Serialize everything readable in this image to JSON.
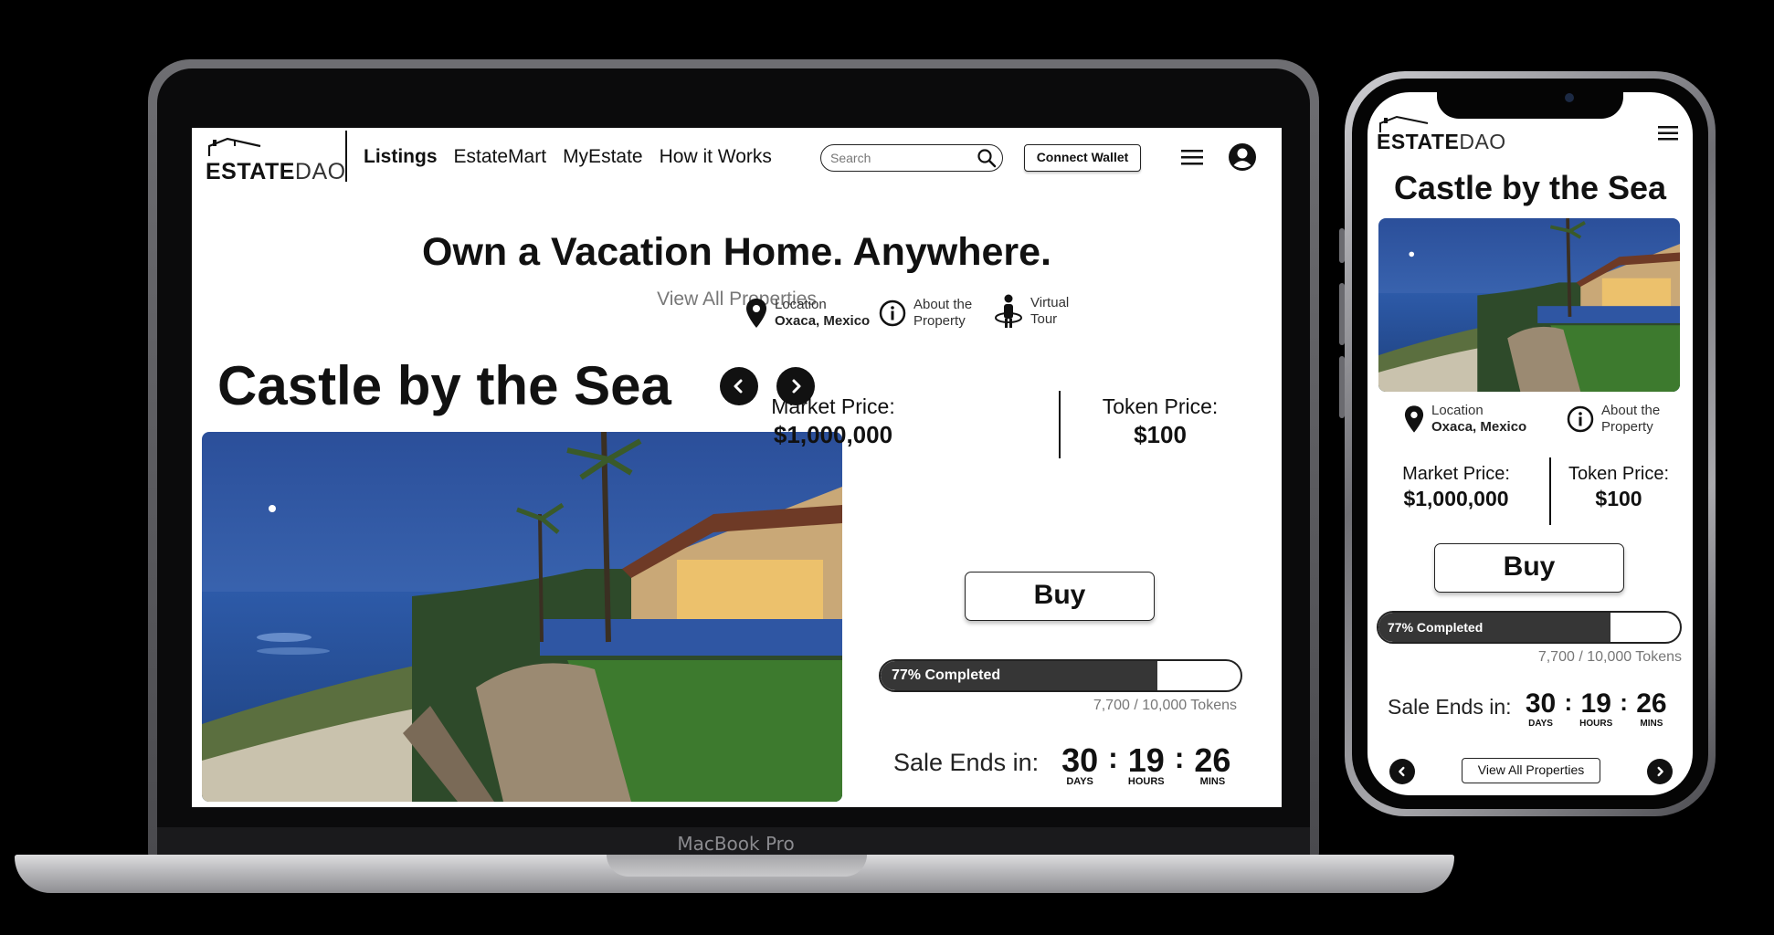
{
  "brand": {
    "logo_bold": "ESTATE",
    "logo_light": "DAO"
  },
  "nav": {
    "items": [
      {
        "label": "Listings",
        "active": true
      },
      {
        "label": "EstateMart",
        "active": false
      },
      {
        "label": "MyEstate",
        "active": false
      },
      {
        "label": "How it Works",
        "active": false
      }
    ]
  },
  "search": {
    "placeholder": "Search"
  },
  "header": {
    "connect_wallet": "Connect Wallet"
  },
  "hero": {
    "title": "Own a Vacation Home. Anywhere.",
    "subtitle": "View All Properties"
  },
  "property": {
    "title": "Castle by the Sea",
    "location_label": "Location",
    "location_value": "Oxaca, Mexico",
    "about_line1": "About the",
    "about_line2": "Property",
    "tour_line1": "Virtual",
    "tour_line2": "Tour",
    "market_price_label": "Market Price:",
    "market_price": "$1,000,000",
    "token_price_label": "Token Price:",
    "token_price": "$100",
    "buy_label": "Buy",
    "progress_label": "77% Completed",
    "progress_percent": 77,
    "tokens_text": "7,700 / 10,000 Tokens",
    "sale_label": "Sale Ends in:",
    "days": "30",
    "days_label": "DAYS",
    "hours": "19",
    "hours_label": "HOURS",
    "mins": "26",
    "mins_label": "MINS"
  },
  "device": {
    "laptop_label": "MacBook Pro"
  },
  "mobile": {
    "view_all": "View All Properties"
  },
  "colors": {
    "accent_dark": "#363636",
    "text": "#111111",
    "muted": "#777777"
  }
}
